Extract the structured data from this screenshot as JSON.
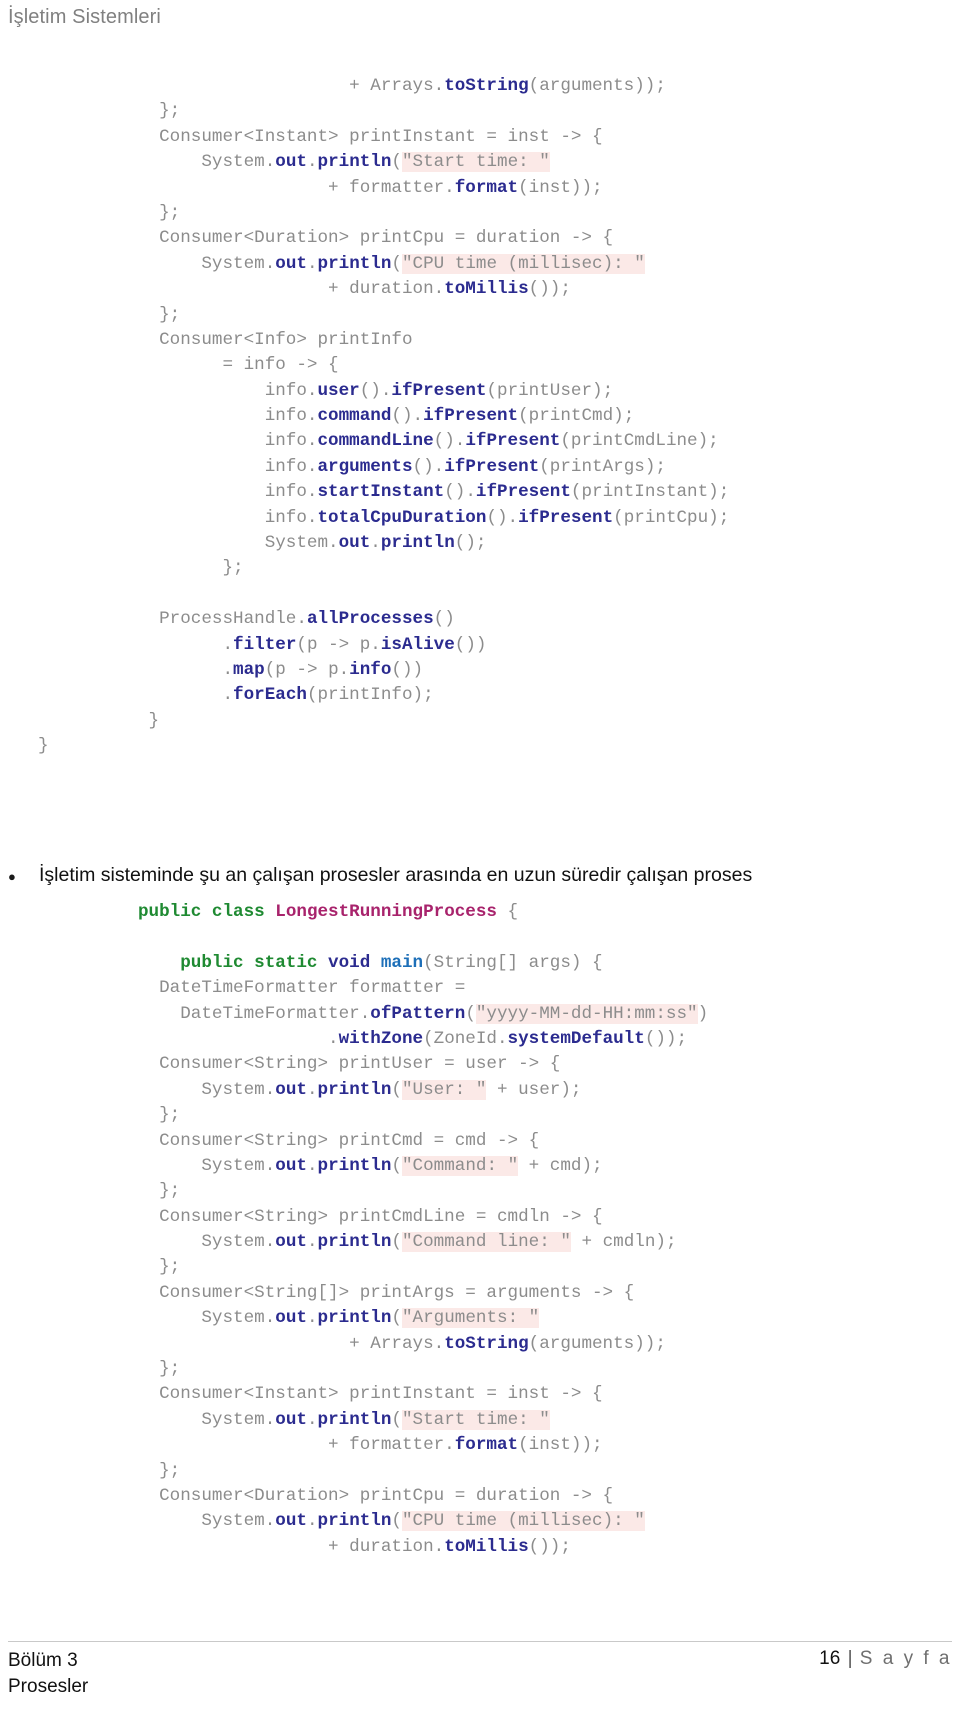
{
  "header": {
    "title": "İşletim Sistemleri"
  },
  "code_top": {
    "name": "java-code-listing-top",
    "lines": [
      [
        {
          "t": "                    + Arrays.",
          "c": "plain"
        },
        {
          "t": "toString",
          "c": "method"
        },
        {
          "t": "(arguments));",
          "c": "plain"
        }
      ],
      [
        {
          "t": "  };",
          "c": "plain"
        }
      ],
      [
        {
          "t": "  Consumer<Instant> printInstant = inst -> {",
          "c": "plain"
        }
      ],
      [
        {
          "t": "      System.",
          "c": "plain"
        },
        {
          "t": "out",
          "c": "method"
        },
        {
          "t": ".",
          "c": "plain"
        },
        {
          "t": "println",
          "c": "method"
        },
        {
          "t": "(",
          "c": "plain"
        },
        {
          "t": "\"Start time: \"",
          "c": "str"
        }
      ],
      [
        {
          "t": "                  + formatter.",
          "c": "plain"
        },
        {
          "t": "format",
          "c": "method"
        },
        {
          "t": "(inst));",
          "c": "plain"
        }
      ],
      [
        {
          "t": "  };",
          "c": "plain"
        }
      ],
      [
        {
          "t": "  Consumer<Duration> printCpu = duration -> {",
          "c": "plain"
        }
      ],
      [
        {
          "t": "      System.",
          "c": "plain"
        },
        {
          "t": "out",
          "c": "method"
        },
        {
          "t": ".",
          "c": "plain"
        },
        {
          "t": "println",
          "c": "method"
        },
        {
          "t": "(",
          "c": "plain"
        },
        {
          "t": "\"CPU time (millisec): \"",
          "c": "str"
        }
      ],
      [
        {
          "t": "                  + duration.",
          "c": "plain"
        },
        {
          "t": "toMillis",
          "c": "method"
        },
        {
          "t": "());",
          "c": "plain"
        }
      ],
      [
        {
          "t": "  };",
          "c": "plain"
        }
      ],
      [
        {
          "t": "  Consumer<Info> printInfo",
          "c": "plain"
        }
      ],
      [
        {
          "t": "        = info -> {",
          "c": "plain"
        }
      ],
      [
        {
          "t": "            info.",
          "c": "plain"
        },
        {
          "t": "user",
          "c": "method"
        },
        {
          "t": "().",
          "c": "plain"
        },
        {
          "t": "ifPresent",
          "c": "method"
        },
        {
          "t": "(printUser);",
          "c": "plain"
        }
      ],
      [
        {
          "t": "            info.",
          "c": "plain"
        },
        {
          "t": "command",
          "c": "method"
        },
        {
          "t": "().",
          "c": "plain"
        },
        {
          "t": "ifPresent",
          "c": "method"
        },
        {
          "t": "(printCmd);",
          "c": "plain"
        }
      ],
      [
        {
          "t": "            info.",
          "c": "plain"
        },
        {
          "t": "commandLine",
          "c": "method"
        },
        {
          "t": "().",
          "c": "plain"
        },
        {
          "t": "ifPresent",
          "c": "method"
        },
        {
          "t": "(printCmdLine);",
          "c": "plain"
        }
      ],
      [
        {
          "t": "            info.",
          "c": "plain"
        },
        {
          "t": "arguments",
          "c": "method"
        },
        {
          "t": "().",
          "c": "plain"
        },
        {
          "t": "ifPresent",
          "c": "method"
        },
        {
          "t": "(printArgs);",
          "c": "plain"
        }
      ],
      [
        {
          "t": "            info.",
          "c": "plain"
        },
        {
          "t": "startInstant",
          "c": "method"
        },
        {
          "t": "().",
          "c": "plain"
        },
        {
          "t": "ifPresent",
          "c": "method"
        },
        {
          "t": "(printInstant);",
          "c": "plain"
        }
      ],
      [
        {
          "t": "            info.",
          "c": "plain"
        },
        {
          "t": "totalCpuDuration",
          "c": "method"
        },
        {
          "t": "().",
          "c": "plain"
        },
        {
          "t": "ifPresent",
          "c": "method"
        },
        {
          "t": "(printCpu);",
          "c": "plain"
        }
      ],
      [
        {
          "t": "            System.",
          "c": "plain"
        },
        {
          "t": "out",
          "c": "method"
        },
        {
          "t": ".",
          "c": "plain"
        },
        {
          "t": "println",
          "c": "method"
        },
        {
          "t": "();",
          "c": "plain"
        }
      ],
      [
        {
          "t": "        };",
          "c": "plain"
        }
      ],
      [
        {
          "t": "",
          "c": "plain"
        }
      ],
      [
        {
          "t": "  ProcessHandle.",
          "c": "plain"
        },
        {
          "t": "allProcesses",
          "c": "method"
        },
        {
          "t": "()",
          "c": "plain"
        }
      ],
      [
        {
          "t": "        .",
          "c": "plain"
        },
        {
          "t": "filter",
          "c": "method"
        },
        {
          "t": "(p -> p.",
          "c": "plain"
        },
        {
          "t": "isAlive",
          "c": "method"
        },
        {
          "t": "())",
          "c": "plain"
        }
      ],
      [
        {
          "t": "        .",
          "c": "plain"
        },
        {
          "t": "map",
          "c": "method"
        },
        {
          "t": "(p -> p.",
          "c": "plain"
        },
        {
          "t": "info",
          "c": "method"
        },
        {
          "t": "())",
          "c": "plain"
        }
      ],
      [
        {
          "t": "        .",
          "c": "plain"
        },
        {
          "t": "forEach",
          "c": "method"
        },
        {
          "t": "(printInfo);",
          "c": "plain"
        }
      ],
      [
        {
          "t": " }",
          "c": "plain"
        }
      ],
      [
        {
          "t": "}",
          "c": "plain",
          "outdent": true
        }
      ]
    ]
  },
  "bullet": {
    "marker": "●",
    "text": "İşletim sisteminde şu an çalışan prosesler arasında en uzun süredir çalışan proses"
  },
  "code_bottom": {
    "name": "java-code-listing-bottom",
    "lines": [
      [
        {
          "t": "public class ",
          "c": "kw"
        },
        {
          "t": "LongestRunningProcess",
          "c": "class"
        },
        {
          "t": " {",
          "c": "plain"
        }
      ],
      [
        {
          "t": "",
          "c": "plain"
        }
      ],
      [
        {
          "t": "    public static ",
          "c": "kw"
        },
        {
          "t": "void",
          "c": "type"
        },
        {
          "t": " ",
          "c": "plain"
        },
        {
          "t": "main",
          "c": "fn"
        },
        {
          "t": "(String[] args) {",
          "c": "plain"
        }
      ],
      [
        {
          "t": "  DateTimeFormatter formatter =",
          "c": "plain"
        }
      ],
      [
        {
          "t": "    DateTimeFormatter.",
          "c": "plain"
        },
        {
          "t": "ofPattern",
          "c": "method"
        },
        {
          "t": "(",
          "c": "plain"
        },
        {
          "t": "\"yyyy-MM-dd-HH:mm:ss\"",
          "c": "str"
        },
        {
          "t": ")",
          "c": "plain"
        }
      ],
      [
        {
          "t": "                  .",
          "c": "plain"
        },
        {
          "t": "withZone",
          "c": "method"
        },
        {
          "t": "(ZoneId.",
          "c": "plain"
        },
        {
          "t": "systemDefault",
          "c": "method"
        },
        {
          "t": "());",
          "c": "plain"
        }
      ],
      [
        {
          "t": "  Consumer<String> printUser = user -> {",
          "c": "plain"
        }
      ],
      [
        {
          "t": "      System.",
          "c": "plain"
        },
        {
          "t": "out",
          "c": "method"
        },
        {
          "t": ".",
          "c": "plain"
        },
        {
          "t": "println",
          "c": "method"
        },
        {
          "t": "(",
          "c": "plain"
        },
        {
          "t": "\"User: \"",
          "c": "str"
        },
        {
          "t": " + user);",
          "c": "plain"
        }
      ],
      [
        {
          "t": "  };",
          "c": "plain"
        }
      ],
      [
        {
          "t": "  Consumer<String> printCmd = cmd -> {",
          "c": "plain"
        }
      ],
      [
        {
          "t": "      System.",
          "c": "plain"
        },
        {
          "t": "out",
          "c": "method"
        },
        {
          "t": ".",
          "c": "plain"
        },
        {
          "t": "println",
          "c": "method"
        },
        {
          "t": "(",
          "c": "plain"
        },
        {
          "t": "\"Command: \"",
          "c": "str"
        },
        {
          "t": " + cmd);",
          "c": "plain"
        }
      ],
      [
        {
          "t": "  };",
          "c": "plain"
        }
      ],
      [
        {
          "t": "  Consumer<String> printCmdLine = cmdln -> {",
          "c": "plain"
        }
      ],
      [
        {
          "t": "      System.",
          "c": "plain"
        },
        {
          "t": "out",
          "c": "method"
        },
        {
          "t": ".",
          "c": "plain"
        },
        {
          "t": "println",
          "c": "method"
        },
        {
          "t": "(",
          "c": "plain"
        },
        {
          "t": "\"Command line: \"",
          "c": "str"
        },
        {
          "t": " + cmdln);",
          "c": "plain"
        }
      ],
      [
        {
          "t": "  };",
          "c": "plain"
        }
      ],
      [
        {
          "t": "  Consumer<String[]> printArgs = arguments -> {",
          "c": "plain"
        }
      ],
      [
        {
          "t": "      System.",
          "c": "plain"
        },
        {
          "t": "out",
          "c": "method"
        },
        {
          "t": ".",
          "c": "plain"
        },
        {
          "t": "println",
          "c": "method"
        },
        {
          "t": "(",
          "c": "plain"
        },
        {
          "t": "\"Arguments: \"",
          "c": "str"
        }
      ],
      [
        {
          "t": "                    + Arrays.",
          "c": "plain"
        },
        {
          "t": "toString",
          "c": "method"
        },
        {
          "t": "(arguments));",
          "c": "plain"
        }
      ],
      [
        {
          "t": "  };",
          "c": "plain"
        }
      ],
      [
        {
          "t": "  Consumer<Instant> printInstant = inst -> {",
          "c": "plain"
        }
      ],
      [
        {
          "t": "      System.",
          "c": "plain"
        },
        {
          "t": "out",
          "c": "method"
        },
        {
          "t": ".",
          "c": "plain"
        },
        {
          "t": "println",
          "c": "method"
        },
        {
          "t": "(",
          "c": "plain"
        },
        {
          "t": "\"Start time: \"",
          "c": "str"
        }
      ],
      [
        {
          "t": "                  + formatter.",
          "c": "plain"
        },
        {
          "t": "format",
          "c": "method"
        },
        {
          "t": "(inst));",
          "c": "plain"
        }
      ],
      [
        {
          "t": "  };",
          "c": "plain"
        }
      ],
      [
        {
          "t": "  Consumer<Duration> printCpu = duration -> {",
          "c": "plain"
        }
      ],
      [
        {
          "t": "      System.",
          "c": "plain"
        },
        {
          "t": "out",
          "c": "method"
        },
        {
          "t": ".",
          "c": "plain"
        },
        {
          "t": "println",
          "c": "method"
        },
        {
          "t": "(",
          "c": "plain"
        },
        {
          "t": "\"CPU time (millisec): \"",
          "c": "str"
        }
      ],
      [
        {
          "t": "                  + duration.",
          "c": "plain"
        },
        {
          "t": "toMillis",
          "c": "method"
        },
        {
          "t": "());",
          "c": "plain"
        }
      ]
    ]
  },
  "footer": {
    "chapter": "Bölüm 3",
    "section": "Prosesler",
    "page_number": "16",
    "separator": "|",
    "page_word": "S a y f a"
  },
  "colors": {
    "header_gray": "#808080",
    "code_gray": "#8c8c8c",
    "method_navy": "#2b2b8f",
    "string_bg": "#fbe9e7",
    "keyword_green": "#1f8a32",
    "class_magenta": "#a8236c",
    "fn_blue": "#1d6fb8",
    "body_text": "#111111",
    "rule_gray": "#c9c9c9"
  }
}
